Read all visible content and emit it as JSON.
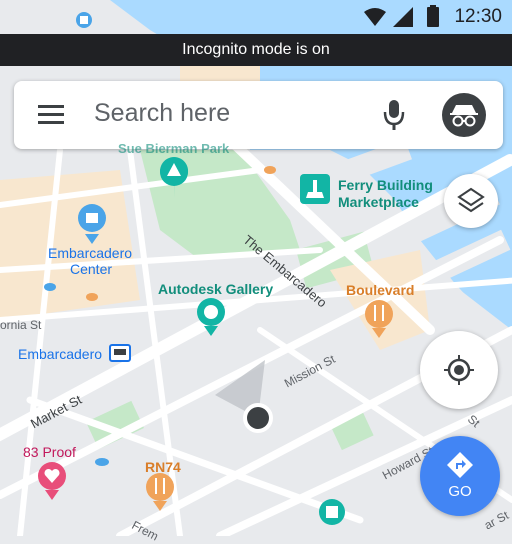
{
  "status_bar": {
    "time": "12:30"
  },
  "banner": {
    "text": "Incognito mode is on"
  },
  "search": {
    "placeholder": "Search here"
  },
  "map_labels": {
    "park_partial": "Sue Bierman Park",
    "ferry_building": "Ferry Building",
    "marketplace": "Marketplace",
    "the_embarcadero": "The Embarcadero",
    "embarcadero_center_1": "Embarcadero",
    "embarcadero_center_2": "Center",
    "autodesk_gallery": "Autodesk Gallery",
    "boulevard": "Boulevard",
    "california_st": "ornia St",
    "embarcadero_station": "Embarcadero",
    "mission_st": "Mission St",
    "market_st": "Market St",
    "proof_83": "83 Proof",
    "rn74": "RN74",
    "howard_st": "Howard St",
    "fremont": "Frem",
    "st_right_1": "St",
    "st_right_2": "ar St"
  },
  "buttons": {
    "go_label": "GO"
  },
  "colors": {
    "water": "#aadaff",
    "land": "#e8eaed",
    "park": "#c5e8c8",
    "block": "#f8e7cf",
    "road": "#ffffff",
    "teal_pin": "#12b5a5",
    "blue_pin": "#4aa4e8",
    "orange_pin": "#f0a35a",
    "pink_pin": "#e84e7a",
    "go_button": "#4285f4",
    "banner": "#202124"
  },
  "icons": [
    "wifi-icon",
    "signal-icon",
    "battery-icon",
    "menu-icon",
    "mic-icon",
    "incognito-icon",
    "layers-icon",
    "my-location-icon",
    "directions-icon",
    "tree-icon",
    "shopping-bag-icon",
    "ferry-icon",
    "gallery-icon",
    "restaurant-icon",
    "transit-icon",
    "heart-icon"
  ]
}
